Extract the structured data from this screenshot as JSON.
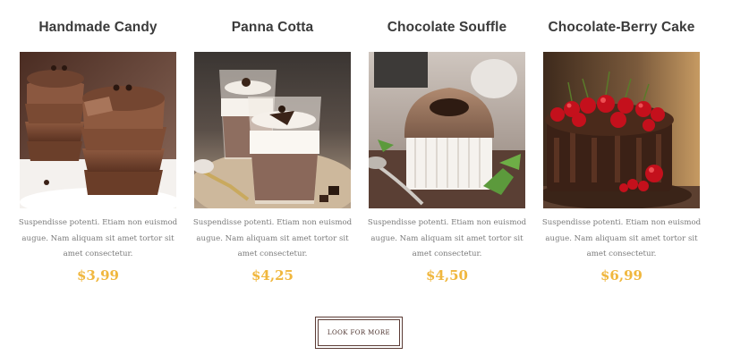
{
  "products": [
    {
      "title": "Handmade Candy",
      "description": "Suspendisse potenti. Etiam non euismod augue. Nam aliquam sit amet tortor sit amet consectetur.",
      "price": "$3,99",
      "image": "handmade-candy-photo"
    },
    {
      "title": "Panna Cotta",
      "description": "Suspendisse potenti. Etiam non euismod augue. Nam aliquam sit amet tortor sit amet consectetur.",
      "price": "$4,25",
      "image": "panna-cotta-photo"
    },
    {
      "title": "Chocolate Souffle",
      "description": "Suspendisse potenti. Etiam non euismod augue. Nam aliquam sit amet tortor sit amet consectetur.",
      "price": "$4,50",
      "image": "chocolate-souffle-photo"
    },
    {
      "title": "Chocolate-Berry Cake",
      "description": "Suspendisse potenti. Etiam non euismod augue. Nam aliquam sit amet tortor sit amet consectetur.",
      "price": "$6,99",
      "image": "chocolate-berry-cake-photo"
    }
  ],
  "more_button": {
    "label": "LOOK FOR MORE"
  },
  "colors": {
    "price": "#f0b73e",
    "title": "#3b3b3b",
    "text": "#7a7a7a",
    "button_border": "#5b3b35"
  }
}
